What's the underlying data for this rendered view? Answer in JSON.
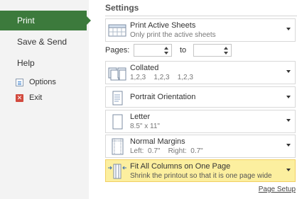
{
  "sidebar": {
    "items": [
      {
        "label": "Print"
      },
      {
        "label": "Save & Send"
      },
      {
        "label": "Help"
      }
    ],
    "sub_items": [
      {
        "label": "Options",
        "icon": "options-icon"
      },
      {
        "label": "Exit",
        "icon": "exit-icon"
      }
    ]
  },
  "settings": {
    "title": "Settings",
    "sheets": {
      "title": "Print Active Sheets",
      "subtitle": "Only print the active sheets"
    },
    "pages": {
      "label": "Pages:",
      "to_label": "to",
      "from_value": "",
      "to_value": ""
    },
    "collated": {
      "title": "Collated",
      "subtitle": "1,2,3    1,2,3    1,2,3"
    },
    "orientation": {
      "title": "Portrait Orientation"
    },
    "paper": {
      "title": "Letter",
      "subtitle": "8.5\" x 11\""
    },
    "margins": {
      "title": "Normal Margins",
      "subtitle": "Left:  0.7\"    Right:  0.7\""
    },
    "scaling": {
      "title": "Fit All Columns on One Page",
      "subtitle": "Shrink the printout so that it is one page wide"
    },
    "page_setup_link": "Page Setup"
  },
  "colors": {
    "active_nav": "#3c7a3c",
    "highlight": "#fcef9f"
  }
}
